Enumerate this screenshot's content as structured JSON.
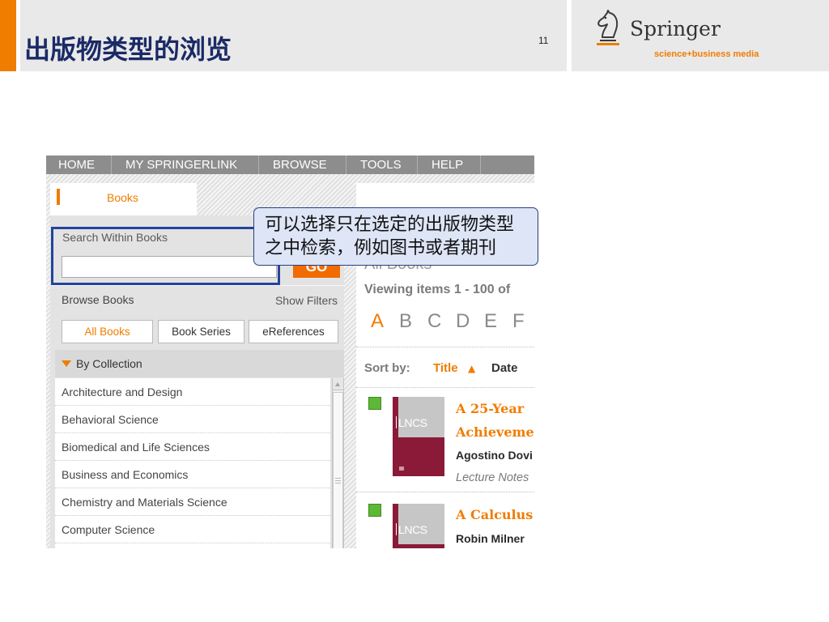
{
  "slide": {
    "title": "出版物类型的浏览",
    "page_number": "11",
    "logo": {
      "icon": "knight-icon",
      "wordmark": "Springer",
      "tagline": "science+business media"
    }
  },
  "colors": {
    "accent_orange": "#f07c00",
    "title_navy": "#1b2a66",
    "header_gray": "#e9e9e9",
    "highlight_blue": "#23449e",
    "callout_fill": "#dde5f6",
    "nav_gray": "#8d8d8d",
    "access_green": "#5cb836",
    "cover_maroon": "#8a1a38"
  },
  "callout": {
    "lines": [
      "可以选择只在选定的出版物类型",
      "之中检索，例如图书或者期刊"
    ]
  },
  "springerlink": {
    "nav": [
      "HOME",
      "MY SPRINGERLINK",
      "BROWSE",
      "TOOLS",
      "HELP"
    ],
    "active_tab": "Books",
    "search": {
      "label": "Search Within Books",
      "value": "",
      "button": "GO"
    },
    "browse": {
      "title": "Browse Books",
      "show_filters": "Show Filters",
      "type_buttons": [
        "All Books",
        "Book Series",
        "eReferences"
      ],
      "selected_type_index": 0
    },
    "collection": {
      "header": "By Collection",
      "expanded": true,
      "items": [
        "Architecture and Design",
        "Behavioral Science",
        "Biomedical and Life Sciences",
        "Business and Economics",
        "Chemistry and Materials Science",
        "Computer Science"
      ]
    },
    "results": {
      "heading": "All Books",
      "viewing": "Viewing items 1 - 100 of",
      "letters": [
        "A",
        "B",
        "C",
        "D",
        "E",
        "F"
      ],
      "selected_letter_index": 0,
      "sort": {
        "label": "Sort by:",
        "options": [
          {
            "label": "Title",
            "indicator": "▲",
            "active": true
          },
          {
            "label": "Date",
            "active": false
          }
        ]
      },
      "items": [
        {
          "cover_label": "LNCS",
          "title_lines": [
            "A 25-Year",
            "Achieveme"
          ],
          "author": "Agostino Dovi",
          "series": "Lecture Notes"
        },
        {
          "cover_label": "LNCS",
          "title_lines": [
            "A Calculus"
          ],
          "author": "Robin Milner"
        }
      ]
    }
  }
}
